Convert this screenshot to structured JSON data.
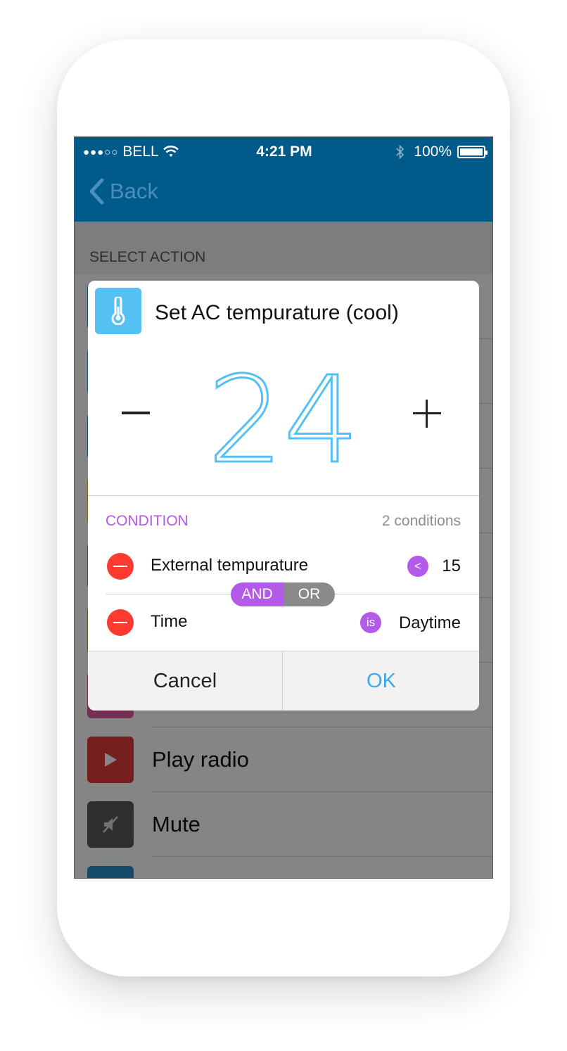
{
  "status_bar": {
    "carrier": "BELL",
    "time": "4:21 PM",
    "battery": "100%"
  },
  "nav": {
    "back_label": "Back"
  },
  "list": {
    "section_label": "SELECT ACTION",
    "items": [
      {
        "label": "Play radio",
        "icon": "play-icon",
        "color": "#e03a3a"
      },
      {
        "label": "Mute",
        "icon": "mute-icon",
        "color": "#5a5a5a"
      }
    ]
  },
  "dialog": {
    "title": "Set AC tempurature (cool)",
    "icon": "thermometer-icon",
    "temperature": "24",
    "condition_header": "CONDITION",
    "condition_count": "2 conditions",
    "conditions": [
      {
        "name": "External tempurature",
        "operator": "<",
        "value": "15"
      },
      {
        "name": "Time",
        "operator": "is",
        "value": "Daytime"
      }
    ],
    "logic": {
      "and_label": "AND",
      "or_label": "OR",
      "selected": "AND"
    },
    "cancel_label": "Cancel",
    "ok_label": "OK"
  },
  "colors": {
    "nav_bar": "#005a8a",
    "accent_blue": "#55c0f2",
    "condition_purple": "#b35ae8",
    "remove_red": "#ff3b30",
    "ok_blue": "#3aa9ee"
  }
}
